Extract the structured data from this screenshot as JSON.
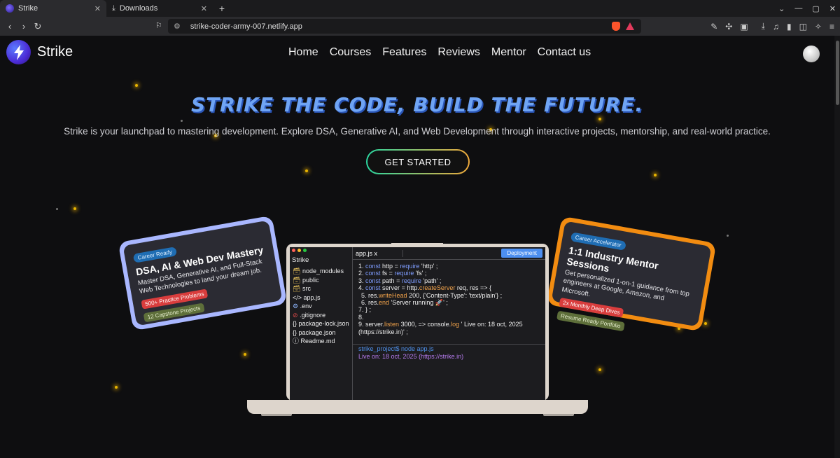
{
  "browser": {
    "tabs": [
      {
        "title": "Strike",
        "active": true
      },
      {
        "title": "Downloads",
        "active": false
      }
    ],
    "url": "strike-coder-army-007.netlify.app"
  },
  "site": {
    "brand": "Strike",
    "nav": [
      "Home",
      "Courses",
      "Features",
      "Reviews",
      "Mentor",
      "Contact us"
    ],
    "hero": {
      "title": "STRIKE THE CODE, BUILD THE FUTURE.",
      "subtitle": "Strike is your launchpad to mastering development. Explore DSA, Generative AI, and Web Development through interactive projects, mentorship, and real-world practice.",
      "cta": "GET STARTED"
    },
    "card_left": {
      "badge": "Career Ready",
      "title": "DSA, AI & Web Dev Mastery",
      "text": "Master DSA, Generative AI, and Full-Stack Web Technologies to land your dream job.",
      "pills": [
        "500+ Practice Problems",
        "12 Capstone Projects"
      ],
      "color": "#a9b7ff"
    },
    "card_right": {
      "badge": "Career Accelerator",
      "title": "1:1 Industry Mentor Sessions",
      "text": "Get personalized 1-on-1 guidance from top engineers at Google, Amazon, and Microsoft.",
      "pills": [
        "2x Monthly Deep Dives",
        "Resume Ready Portfolio"
      ],
      "color": "#f28c11"
    },
    "ide": {
      "project": "Strike",
      "files": [
        "node_modules",
        "public",
        "src",
        "</> app.js",
        ".env",
        ".gitignore",
        "{} package-lock.json",
        "{} package.json",
        "Readme.md"
      ],
      "open_tab": "app.js x",
      "deploy_label": "Deployment",
      "code": [
        {
          "n": "1.",
          "text": "const http = require 'http' ;"
        },
        {
          "n": "2.",
          "text": "const fs = require 'fs' ;"
        },
        {
          "n": "3.",
          "text": "const path = require 'path' ;"
        },
        {
          "n": "4.",
          "text": "const server = http.createServer req, res => {"
        },
        {
          "n": "5.",
          "text": "res.writeHead 200, {'Content-Type': 'text/plain'} ;"
        },
        {
          "n": "6.",
          "text": "res.end 'Server running 🚀' ;"
        },
        {
          "n": "7.",
          "text": "} ;"
        },
        {
          "n": "8.",
          "text": ""
        },
        {
          "n": "9.",
          "text": "server.listen 3000, => console.log ' Live on: 18 oct, 2025 (https://strike.in)' ;"
        }
      ],
      "terminal_prompt": "strike_project$  node app.js",
      "terminal_output": "Live on: 18 oct, 2025 (https://strike.in)"
    }
  }
}
